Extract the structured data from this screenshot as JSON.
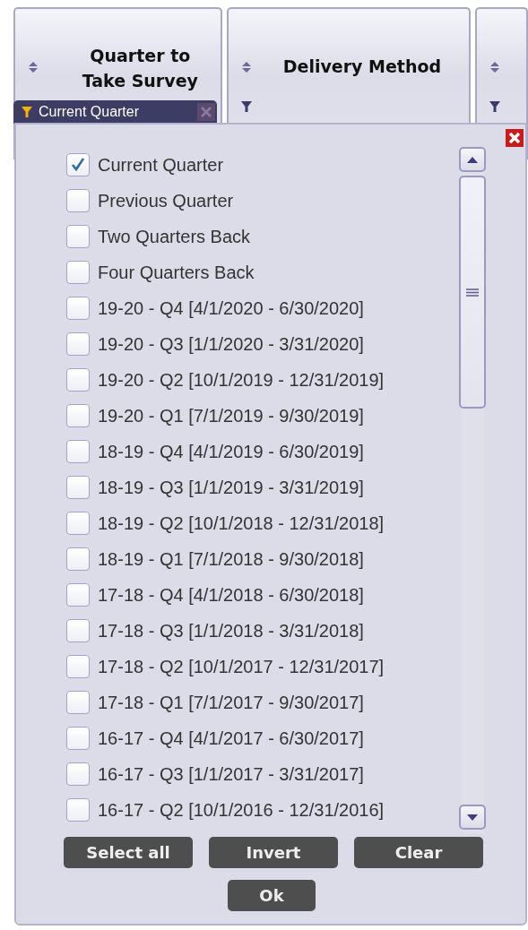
{
  "columns": [
    {
      "title": "Quarter to Take Survey",
      "filter_chip": "Current Quarter"
    },
    {
      "title": "Delivery Method"
    },
    {}
  ],
  "filter_popup": {
    "items": [
      {
        "label": "Current Quarter",
        "checked": true
      },
      {
        "label": "Previous Quarter",
        "checked": false
      },
      {
        "label": "Two Quarters Back",
        "checked": false
      },
      {
        "label": "Four Quarters Back",
        "checked": false
      },
      {
        "label": "19-20 - Q4 [4/1/2020 - 6/30/2020]",
        "checked": false
      },
      {
        "label": "19-20 - Q3 [1/1/2020 - 3/31/2020]",
        "checked": false
      },
      {
        "label": "19-20 - Q2 [10/1/2019 - 12/31/2019]",
        "checked": false
      },
      {
        "label": "19-20 - Q1 [7/1/2019 - 9/30/2019]",
        "checked": false
      },
      {
        "label": "18-19 - Q4 [4/1/2019 - 6/30/2019]",
        "checked": false
      },
      {
        "label": "18-19 - Q3 [1/1/2019 - 3/31/2019]",
        "checked": false
      },
      {
        "label": "18-19 - Q2 [10/1/2018 - 12/31/2018]",
        "checked": false
      },
      {
        "label": "18-19 - Q1 [7/1/2018 - 9/30/2018]",
        "checked": false
      },
      {
        "label": "17-18 - Q4 [4/1/2018 - 6/30/2018]",
        "checked": false
      },
      {
        "label": "17-18 - Q3 [1/1/2018 - 3/31/2018]",
        "checked": false
      },
      {
        "label": "17-18 - Q2 [10/1/2017 - 12/31/2017]",
        "checked": false
      },
      {
        "label": "17-18 - Q1 [7/1/2017 - 9/30/2017]",
        "checked": false
      },
      {
        "label": "16-17 - Q4 [4/1/2017 - 6/30/2017]",
        "checked": false
      },
      {
        "label": "16-17 - Q3 [1/1/2017 - 3/31/2017]",
        "checked": false
      },
      {
        "label": "16-17 - Q2 [10/1/2016 - 12/31/2016]",
        "checked": false
      }
    ],
    "buttons": [
      "Select all",
      "Invert",
      "Clear"
    ],
    "ok_button": "Ok"
  }
}
